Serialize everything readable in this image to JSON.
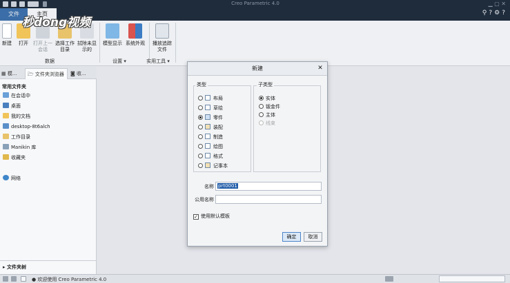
{
  "app": {
    "title": "Creo Parametric 4.0"
  },
  "watermark": "秒dong视频",
  "ribbon": {
    "tabs": [
      {
        "label": "文件"
      },
      {
        "label": "主页"
      }
    ],
    "buttons": {
      "new": "新建",
      "open": "打开",
      "open_last": "打开上一会话",
      "select_workdir": "选择工作目录",
      "erase_not_displayed": "拭除未显示的",
      "model_display": "模型显示",
      "system_appearance": "系统外观",
      "play_trail": "播放追踪文件"
    },
    "groups": {
      "data": "数据",
      "settings": "设置 ▾",
      "utilities": "实用工具 ▾"
    }
  },
  "left_panel": {
    "tabs": [
      {
        "label": "模..."
      },
      {
        "label": "文件夹浏览器"
      },
      {
        "label": "收..."
      }
    ],
    "favorites_heading": "常用文件夹",
    "items": [
      {
        "label": "在会话中",
        "icon": "session-icon"
      },
      {
        "label": "桌面",
        "icon": "desktop-icon"
      },
      {
        "label": "我的文档",
        "icon": "documents-icon"
      },
      {
        "label": "desktop-8t6alch",
        "icon": "computer-icon"
      },
      {
        "label": "工作目录",
        "icon": "workdir-icon"
      },
      {
        "label": "Manikin 库",
        "icon": "manikin-icon"
      },
      {
        "label": "收藏夹",
        "icon": "favorites-icon"
      },
      {
        "label": "网络",
        "icon": "network-icon"
      }
    ],
    "folder_tree": "▸ 文件夹树"
  },
  "dialog": {
    "title": "新建",
    "type_legend": "类型",
    "subtype_legend": "子类型",
    "types": [
      {
        "label": "布局",
        "selected": false
      },
      {
        "label": "草绘",
        "selected": false
      },
      {
        "label": "零件",
        "selected": true
      },
      {
        "label": "装配",
        "selected": false
      },
      {
        "label": "制造",
        "selected": false
      },
      {
        "label": "绘图",
        "selected": false
      },
      {
        "label": "格式",
        "selected": false
      },
      {
        "label": "记事本",
        "selected": false
      }
    ],
    "subtypes": [
      {
        "label": "实体",
        "selected": true,
        "disabled": false
      },
      {
        "label": "钣金件",
        "selected": false,
        "disabled": false
      },
      {
        "label": "主体",
        "selected": false,
        "disabled": false
      },
      {
        "label": "线束",
        "selected": false,
        "disabled": true
      }
    ],
    "name_label": "名称",
    "name_value": "prt0001",
    "common_name_label": "公用名称",
    "common_name_value": "",
    "use_default_template_label": "使用默认模板",
    "use_default_template_checked": "✓",
    "ok_label": "确定",
    "cancel_label": "取消"
  },
  "status_bar": {
    "message": "● 欢迎使用 Creo Parametric 4.0"
  },
  "colors": {
    "title_bar": "#1f2c3c",
    "file_tab": "#3b6ea8",
    "selection": "#1e5aa8"
  }
}
